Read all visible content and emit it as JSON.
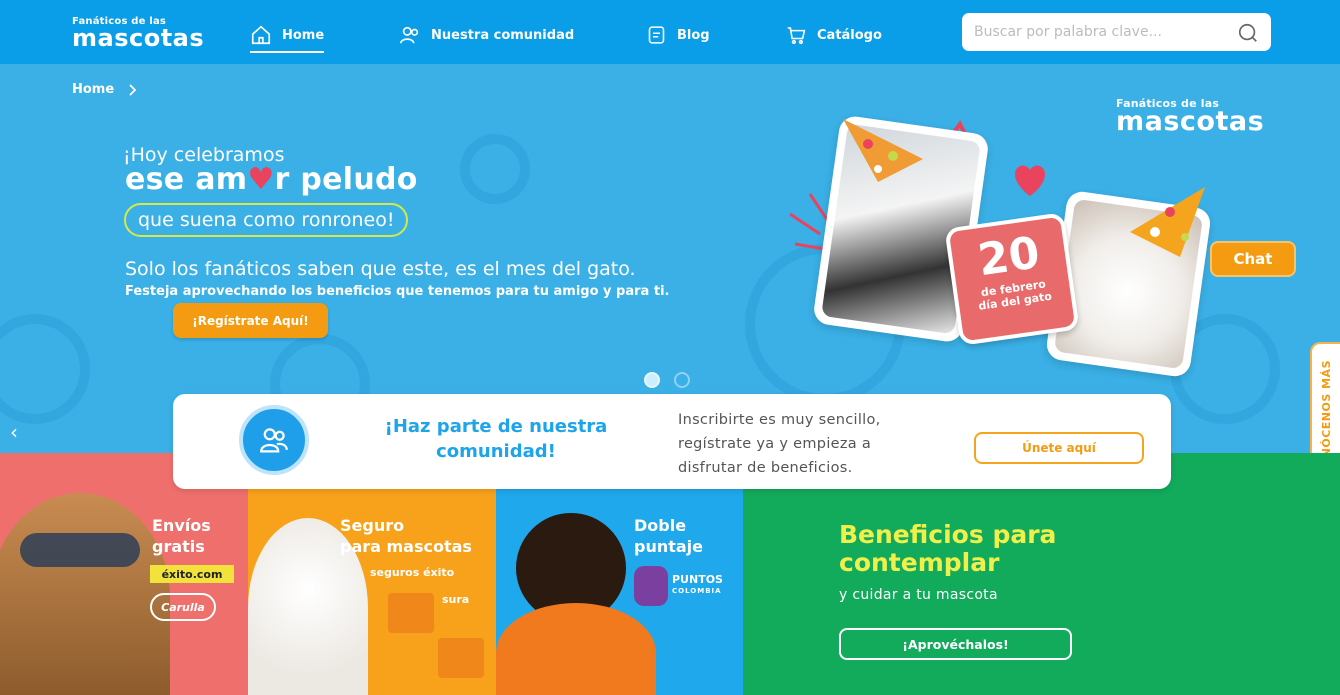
{
  "header": {
    "logo_small": "Fanáticos de las",
    "logo_big": "mascotas",
    "nav": [
      {
        "label": "Home",
        "icon": "home-icon",
        "active": true
      },
      {
        "label": "Nuestra comunidad",
        "icon": "community-icon",
        "active": false
      },
      {
        "label": "Blog",
        "icon": "blog-icon",
        "active": false
      },
      {
        "label": "Catálogo",
        "icon": "cart-icon",
        "active": false
      }
    ],
    "search_placeholder": "Buscar por palabra clave..."
  },
  "hero": {
    "breadcrumb": "Home",
    "line1": "¡Hoy celebramos",
    "line2_a": "ese am",
    "line2_b": "r peludo",
    "pill": "que suena como ronroneo!",
    "line3": "Solo los fanáticos saben que este, es el mes del gato.",
    "line4": "Festeja aprovechando los beneficios que tenemos para tu amigo y para ti.",
    "cta": "¡Regístrate Aquí!",
    "logo_small": "Fanáticos de las",
    "logo_big": "mascotas",
    "date_number": "20",
    "date_line1": "de febrero",
    "date_line2": "día del gato",
    "chat": "Chat"
  },
  "side_tab": "CONÓCENOS MÁS",
  "community": {
    "title": "¡Haz parte de nuestra comunidad!",
    "text": "Inscribirte es muy sencillo, regístrate ya y empieza a disfrutar de beneficios.",
    "button": "Únete aquí"
  },
  "tiles": {
    "t1_title_1": "Envíos",
    "t1_title_2": "gratis",
    "t1_badge_1": "éxito.com",
    "t1_badge_2": "Carulla",
    "t2_title_1": "Seguro",
    "t2_title_2": "para mascotas",
    "t2_badge_1": "seguros éxito",
    "t2_badge_2": "sura",
    "t3_title_1": "Doble",
    "t3_title_2": "puntaje",
    "t3_badge_1": "PUNTOS",
    "t3_badge_2": "COLOMBIA",
    "t4_title_1": "Beneficios para",
    "t4_title_2": "contemplar",
    "t4_sub": "y cuidar a tu mascota",
    "t4_button": "¡Aprovéchalos!"
  },
  "colors": {
    "header_bg": "#0a9ee8",
    "hero_bg": "#3ab0e6",
    "orange": "#f59b11",
    "coral": "#ef6f6c",
    "green": "#12aa5b",
    "yellow": "#f1f04b"
  }
}
